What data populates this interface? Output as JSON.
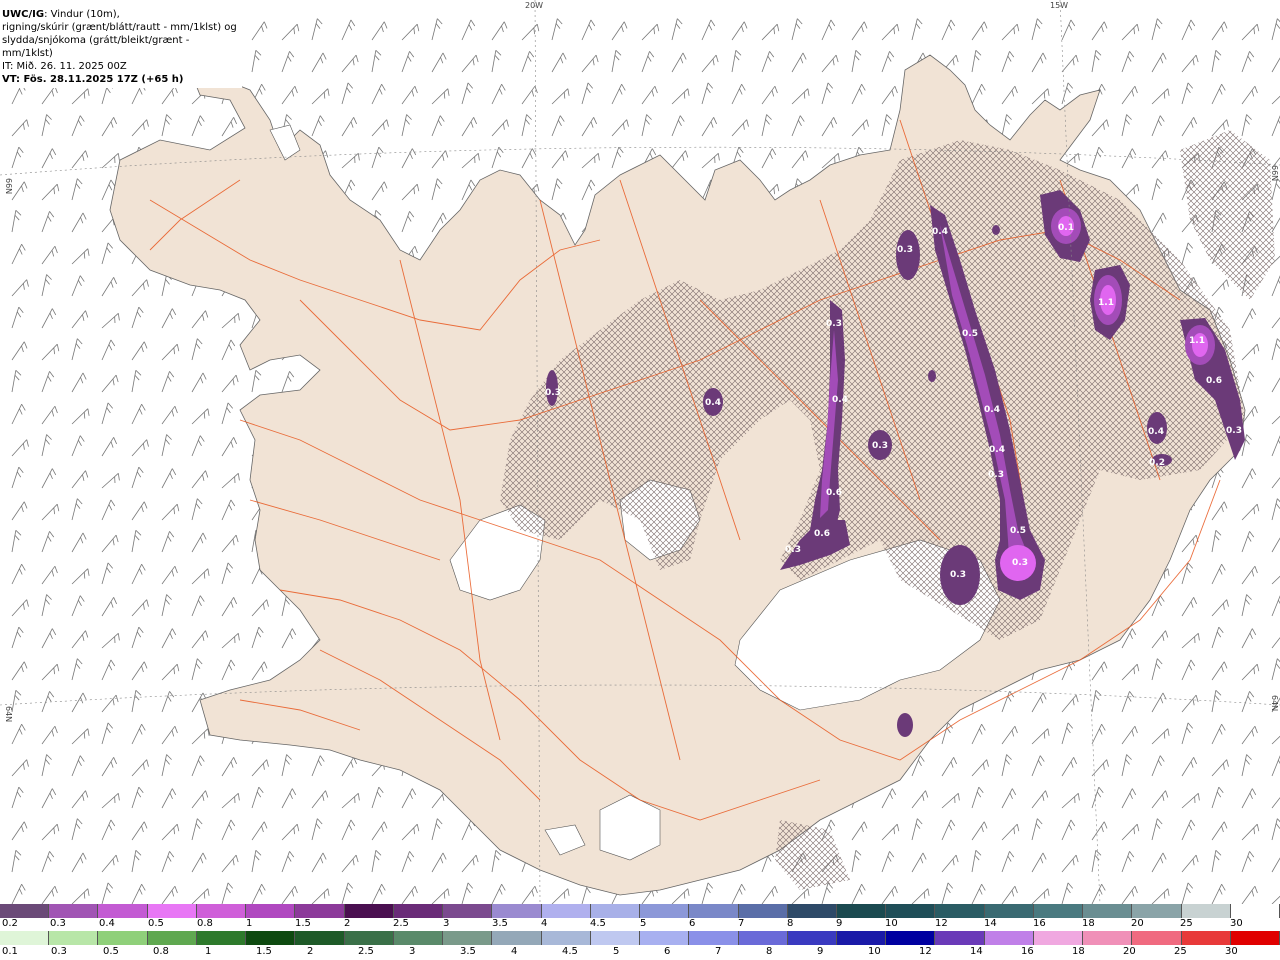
{
  "header": {
    "line1_bold": "UWC/IG",
    "line1_rest": ": Vindur (10m),",
    "line2": "rigning/skúrir (grænt/blátt/rautt - mm/1klst) og",
    "line3": "slydda/snjókoma (grátt/bleikt/grænt - mm/1klst)",
    "line4": "IT: Mið. 26. 11. 2025 00Z",
    "line5": "VT: Fös. 28.11.2025 17Z (+65 h)"
  },
  "coord_labels": {
    "top_20w": "20W",
    "top_15w": "15W",
    "left_66n": "66N",
    "left_64n": "64N",
    "right_66n": "66N",
    "right_64n": "64N"
  },
  "colors": {
    "land": "#f1e3d5",
    "sea": "#ffffff",
    "roads": "#e8571e",
    "glacier": "#ffffff",
    "snow_dark": "#6b3a78",
    "snow_mid": "#a34cb8",
    "snow_light": "#e066f0"
  },
  "precip_values": [
    {
      "label": "0.4"
    },
    {
      "label": "0.3"
    },
    {
      "label": "0.5"
    },
    {
      "label": "0.4"
    },
    {
      "label": "0.4"
    },
    {
      "label": "0.3"
    },
    {
      "label": "0.6"
    },
    {
      "label": "0.5"
    },
    {
      "label": "0.3"
    },
    {
      "label": "0.3"
    },
    {
      "label": "0.6"
    },
    {
      "label": "0.4"
    },
    {
      "label": "0.3"
    },
    {
      "label": "0.3"
    },
    {
      "label": "0.4"
    },
    {
      "label": "0.3"
    },
    {
      "label": "0.1"
    },
    {
      "label": "1.1"
    },
    {
      "label": "1.1"
    },
    {
      "label": "0.6"
    },
    {
      "label": "0.4"
    },
    {
      "label": "0.2"
    },
    {
      "label": "0.3"
    },
    {
      "label": "0.3"
    }
  ],
  "legend_snow": {
    "labels": [
      "0.2",
      "0.3",
      "0.4",
      "0.5",
      "0.8",
      "1",
      "1.5",
      "2",
      "2.5",
      "3",
      "3.5",
      "4",
      "4.5",
      "5",
      "6",
      "7",
      "8",
      "9",
      "10",
      "12",
      "14",
      "16",
      "18",
      "20",
      "25",
      "30"
    ],
    "colors": [
      "#6b4a78",
      "#a155b4",
      "#c35bd3",
      "#e877f5",
      "#cf5fd9",
      "#b048c0",
      "#8c3a9a",
      "#4a0f50",
      "#6a2b78",
      "#7b4a8f",
      "#9a8ad0",
      "#b0b0ee",
      "#a8b0e8",
      "#8c98d8",
      "#7a88c8",
      "#5a6ea8",
      "#2e4a68",
      "#1b4a50",
      "#1f4e58",
      "#2a5c64",
      "#3a6a72",
      "#4a7a80",
      "#6a8e92",
      "#8aa4a8",
      "#c8d2d2",
      "#ffffff"
    ]
  },
  "legend_rain": {
    "labels": [
      "0.1",
      "0.3",
      "0.5",
      "0.8",
      "1",
      "1.5",
      "2",
      "2.5",
      "3",
      "3.5",
      "4",
      "4.5",
      "5",
      "6",
      "7",
      "8",
      "9",
      "10",
      "12",
      "14",
      "16",
      "18",
      "20",
      "25",
      "30"
    ],
    "colors": [
      "#dff5d8",
      "#b8e6a8",
      "#8fd07a",
      "#5fa850",
      "#2e7a2c",
      "#0e4a10",
      "#1e5a28",
      "#3a7048",
      "#5a8a6a",
      "#7a9a8a",
      "#94a8b8",
      "#a8b8d8",
      "#bfc8f0",
      "#a8b0f0",
      "#8a90e8",
      "#6a6ad8",
      "#3a3ac0",
      "#1a1aa8",
      "#0000a0",
      "#6a3ab8",
      "#c080e8",
      "#f0a8e0",
      "#f090b8",
      "#f06a80",
      "#e83a3a",
      "#e00000"
    ]
  }
}
